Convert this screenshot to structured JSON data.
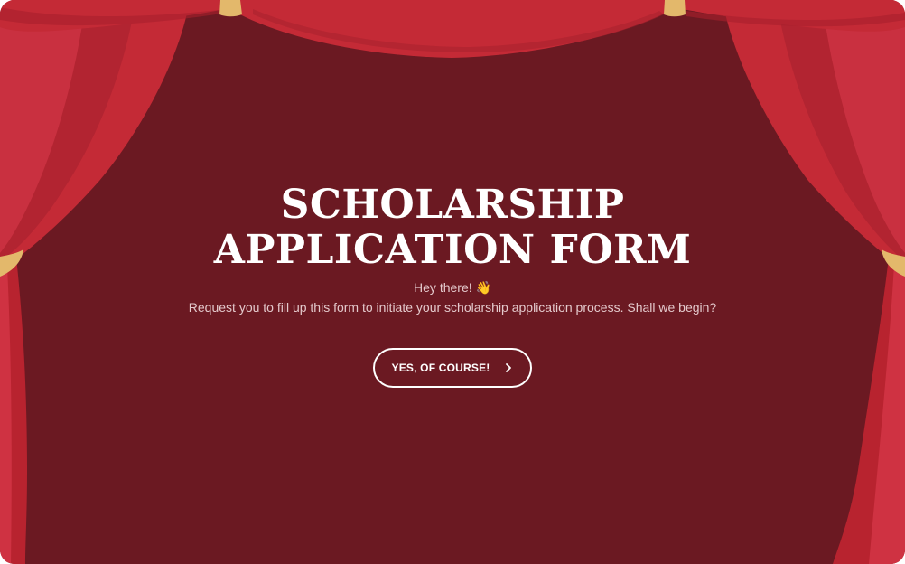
{
  "title_line1": "SCHOLARSHIP",
  "title_line2": "APPLICATION FORM",
  "greeting": "Hey there!",
  "greeting_emoji": "👋",
  "description": "Request you to fill up this form to initiate your scholarship application process. Shall we begin?",
  "cta": {
    "label": "YES, OF COURSE!",
    "icon": "chevron-right-icon"
  },
  "colors": {
    "background": "#6b1922",
    "curtain": "#c42a36",
    "curtain_dark": "#a8202d",
    "tieback": "#e3b86b",
    "text": "#ffffff",
    "subtext": "#e4c9cc"
  }
}
